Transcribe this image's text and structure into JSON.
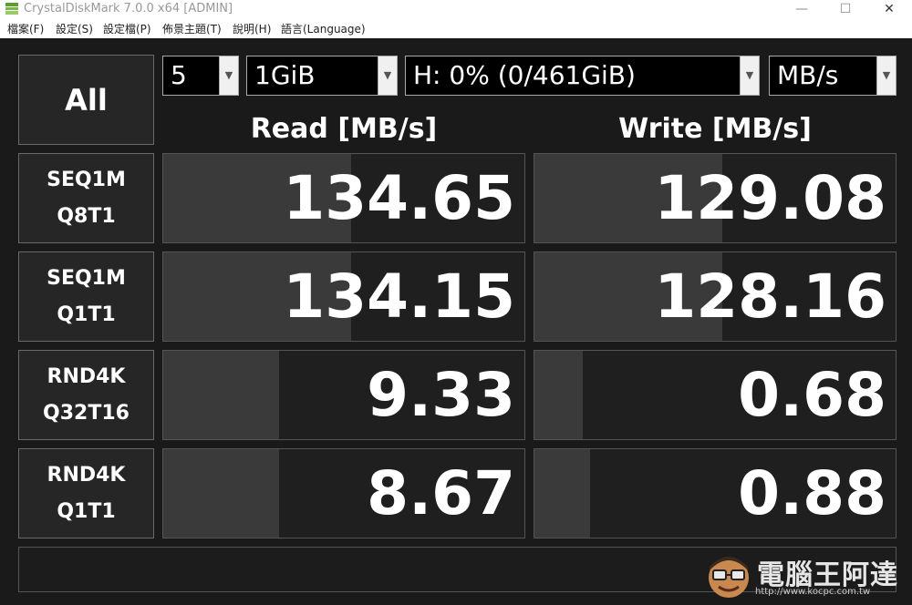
{
  "window": {
    "title": "CrystalDiskMark 7.0.0 x64 [ADMIN]",
    "minimize": "—",
    "maximize": "☐",
    "close": "✕"
  },
  "menu": [
    {
      "label": "檔案(F)"
    },
    {
      "label": "設定(S)"
    },
    {
      "label": "設定檔(P)"
    },
    {
      "label": "佈景主題(T)"
    },
    {
      "label": "說明(H)"
    },
    {
      "label": "語言(Language)"
    }
  ],
  "controls": {
    "all_label": "All",
    "count": "5",
    "size": "1GiB",
    "drive": "H: 0% (0/461GiB)",
    "unit": "MB/s"
  },
  "headers": {
    "read": "Read [MB/s]",
    "write": "Write [MB/s]"
  },
  "tests": [
    {
      "line1": "SEQ1M",
      "line2": "Q8T1",
      "read": "134.65",
      "write": "129.08",
      "read_fill": 0.52,
      "write_fill": 0.52
    },
    {
      "line1": "SEQ1M",
      "line2": "Q1T1",
      "read": "134.15",
      "write": "128.16",
      "read_fill": 0.52,
      "write_fill": 0.52
    },
    {
      "line1": "RND4K",
      "line2": "Q32T16",
      "read": "9.33",
      "write": "0.68",
      "read_fill": 0.32,
      "write_fill": 0.135
    },
    {
      "line1": "RND4K",
      "line2": "Q1T1",
      "read": "8.67",
      "write": "0.88",
      "read_fill": 0.32,
      "write_fill": 0.155
    }
  ],
  "comment": "",
  "watermark": {
    "brand": "電腦王阿達",
    "url": "http://www.kocpc.com.tw"
  },
  "colors": {
    "background": "#1a1a1a",
    "panel": "#262626",
    "bar": "#3a3a3a",
    "text": "#ffffff"
  }
}
